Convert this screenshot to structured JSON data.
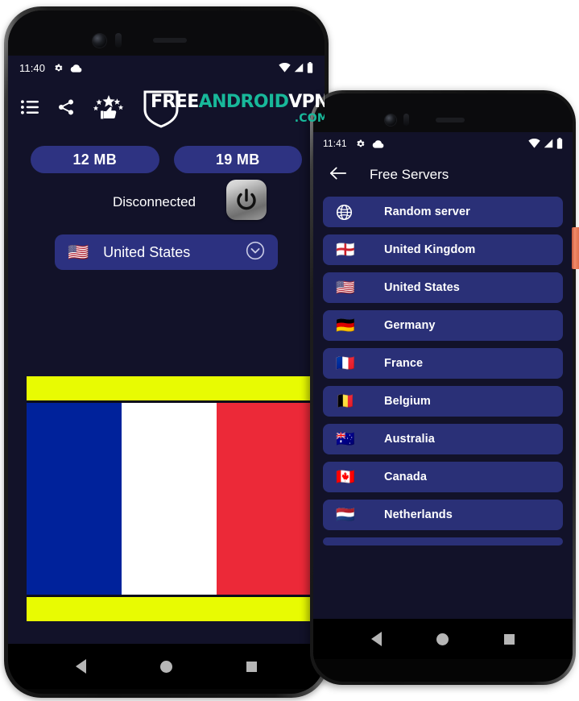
{
  "background_color": "#ffffff",
  "accent": {
    "pill_blue": "#2e3382",
    "item_blue": "#2a3077",
    "app_bg": "#121229",
    "brand_teal": "#18b89a",
    "banner_yellow": "#e8fb02"
  },
  "phone1": {
    "status_bar": {
      "time": "11:40",
      "left_icons": [
        "gear-icon",
        "cloud-icon"
      ],
      "right_icons": [
        "wifi-icon",
        "signal-icon",
        "battery-icon"
      ]
    },
    "toolbar": {
      "icons": [
        {
          "name": "menu-list-icon",
          "label": "Menu"
        },
        {
          "name": "share-icon",
          "label": "Share"
        },
        {
          "name": "rate-thumbs-up-icon",
          "label": "Rate"
        }
      ],
      "brand": {
        "part1": "FREE",
        "part2": "ANDROID",
        "part3": "VPN",
        "part4": ".COM",
        "shield": "shield-icon"
      }
    },
    "traffic": {
      "download_label": "12 MB",
      "upload_label": "19 MB"
    },
    "connection": {
      "status_text": "Disconnected",
      "power_button": "power-icon"
    },
    "country_selector": {
      "flag": "🇺🇸",
      "label": "United States",
      "chevron": "chevron-down-circle-icon"
    },
    "banner": {
      "type": "france-flag-banner",
      "top_bar_color": "#e8fb02",
      "bottom_bar_color": "#e8fb02",
      "stripes": [
        "#00229b",
        "#ffffff",
        "#ec2938"
      ]
    },
    "nav_bar": {
      "back": "back-triangle-icon",
      "home": "home-circle-icon",
      "recents": "recents-square-icon"
    }
  },
  "phone2": {
    "status_bar": {
      "time": "11:41",
      "left_icons": [
        "gear-icon",
        "cloud-icon"
      ],
      "right_icons": [
        "wifi-icon",
        "signal-icon",
        "battery-icon"
      ]
    },
    "app_bar": {
      "back": "back-arrow-icon",
      "title": "Free Servers"
    },
    "servers": [
      {
        "flag": "globe-icon",
        "label": "Random server"
      },
      {
        "flag": "🏴󠁧󠁢󠁥󠁮󠁧󠁿",
        "label": "United Kingdom"
      },
      {
        "flag": "🇺🇸",
        "label": "United States"
      },
      {
        "flag": "🇩🇪",
        "label": "Germany"
      },
      {
        "flag": "🇫🇷",
        "label": "France"
      },
      {
        "flag": "🇧🇪",
        "label": "Belgium"
      },
      {
        "flag": "🇦🇺",
        "label": "Australia"
      },
      {
        "flag": "🇨🇦",
        "label": "Canada"
      },
      {
        "flag": "🇳🇱",
        "label": "Netherlands"
      }
    ],
    "nav_bar": {
      "back": "back-triangle-icon",
      "home": "home-circle-icon",
      "recents": "recents-square-icon"
    }
  }
}
